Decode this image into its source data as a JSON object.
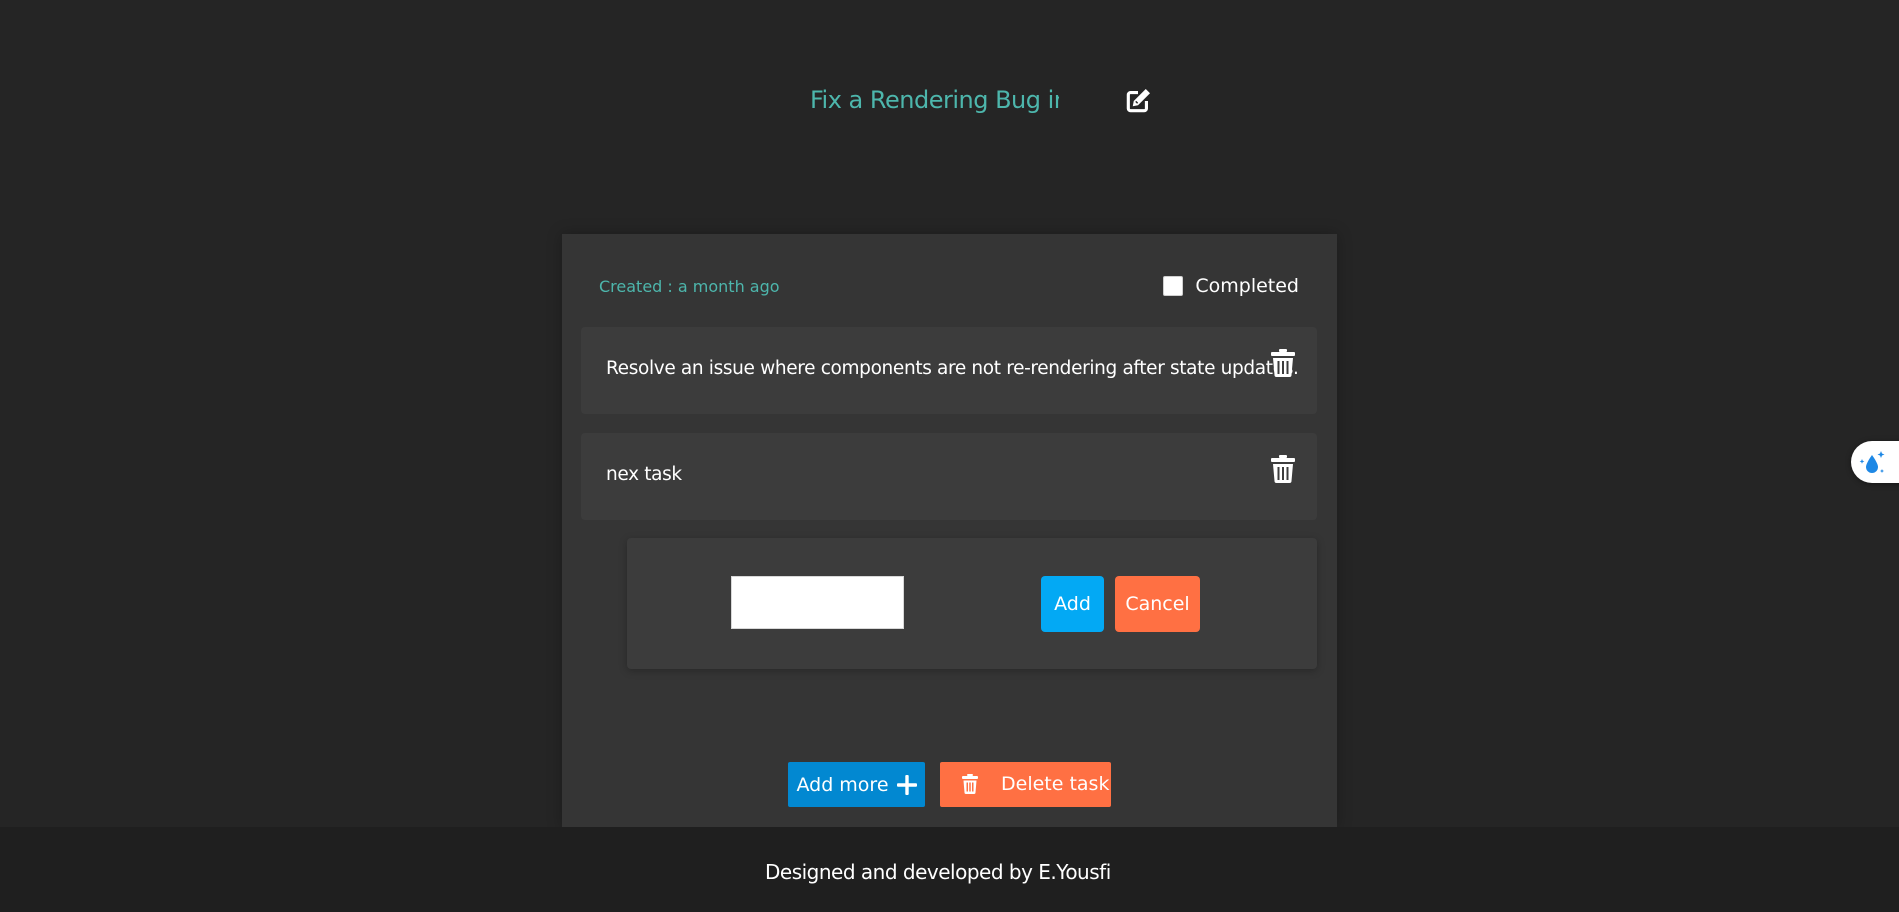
{
  "task": {
    "title": "Fix a Rendering Bug in React",
    "created_label": "Created : a month ago",
    "completed_label": "Completed",
    "completed": false,
    "subtasks": [
      {
        "text": "Resolve an issue where components are not re-rendering after state updates."
      },
      {
        "text": "nex task"
      }
    ]
  },
  "add_form": {
    "input_value": "",
    "add_label": "Add",
    "cancel_label": "Cancel"
  },
  "actions": {
    "add_more_label": "Add more",
    "delete_task_label": "Delete task"
  },
  "footer": {
    "credit": "Designed and developed by E.Yousfi"
  },
  "icons": {
    "title_edit": "edit-icon",
    "subtask_delete": "trash-icon",
    "add_more": "plus-icon",
    "delete_task": "trash-icon",
    "side_widget": "sparkle-droplet-icon"
  },
  "colors": {
    "background": "#252525",
    "card": "#353535",
    "accent_teal": "#4db6ac",
    "primary_blue": "#03a9f4",
    "add_more_blue": "#0288d1",
    "danger_orange": "#ff7043",
    "footer": "#1f1f1f"
  }
}
